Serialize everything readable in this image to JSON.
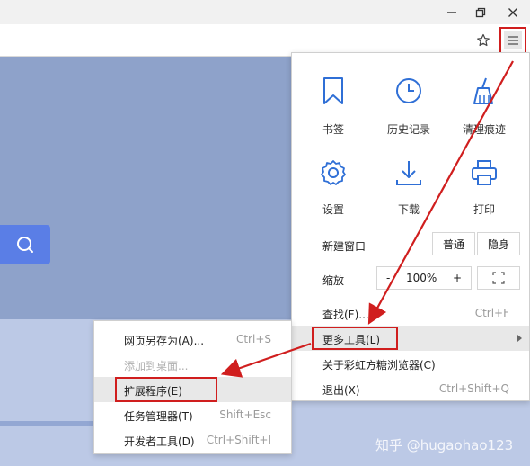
{
  "window": {
    "controls": [
      "minimize-icon",
      "restore-icon",
      "close-icon"
    ]
  },
  "toolbar": {
    "icons": [
      "star-icon",
      "hamburger-menu-icon"
    ]
  },
  "main_menu": {
    "tiles": [
      {
        "label": "书签",
        "icon": "bookmark-icon"
      },
      {
        "label": "历史记录",
        "icon": "clock-icon"
      },
      {
        "label": "清理痕迹",
        "icon": "broom-icon"
      },
      {
        "label": "设置",
        "icon": "gear-icon"
      },
      {
        "label": "下载",
        "icon": "download-icon"
      },
      {
        "label": "打印",
        "icon": "printer-icon"
      }
    ],
    "new_window": {
      "label": "新建窗口",
      "normal": "普通",
      "incognito": "隐身"
    },
    "zoom": {
      "label": "缩放",
      "minus": "-",
      "value": "100%",
      "plus": "+"
    },
    "find": {
      "label": "查找(F)...",
      "shortcut": "Ctrl+F"
    },
    "more_tools": {
      "label": "更多工具(L)"
    },
    "about": {
      "label": "关于彩虹方糖浏览器(C)"
    },
    "exit": {
      "label": "退出(X)",
      "shortcut": "Ctrl+Shift+Q"
    }
  },
  "sub_menu": {
    "items": [
      {
        "label": "网页另存为(A)...",
        "shortcut": "Ctrl+S"
      },
      {
        "label": "添加到桌面...",
        "shortcut": ""
      },
      {
        "label": "扩展程序(E)",
        "shortcut": ""
      },
      {
        "label": "任务管理器(T)",
        "shortcut": "Shift+Esc"
      },
      {
        "label": "开发者工具(D)",
        "shortcut": "Ctrl+Shift+I"
      }
    ]
  },
  "watermark": {
    "text": "知乎 @hugaohao123"
  },
  "colors": {
    "annotation": "#d01e1e",
    "page_bg": "#8ea2ca",
    "accent": "#2f6fd6"
  }
}
